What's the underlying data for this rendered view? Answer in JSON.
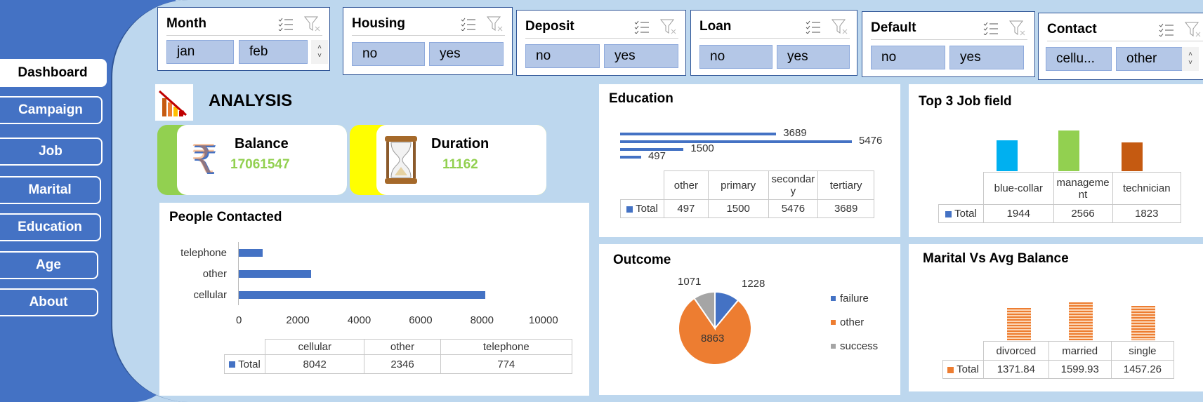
{
  "nav": [
    {
      "label": "Dashboard",
      "active": true
    },
    {
      "label": "Campaign"
    },
    {
      "label": "Job"
    },
    {
      "label": "Marital"
    },
    {
      "label": "Education"
    },
    {
      "label": "Age"
    },
    {
      "label": "About"
    }
  ],
  "slicers": {
    "month": {
      "title": "Month",
      "items": [
        "jan",
        "feb"
      ]
    },
    "housing": {
      "title": "Housing",
      "items": [
        "no",
        "yes"
      ]
    },
    "deposit": {
      "title": "Deposit",
      "items": [
        "no",
        "yes"
      ]
    },
    "loan": {
      "title": "Loan",
      "items": [
        "no",
        "yes"
      ]
    },
    "default": {
      "title": "Default",
      "items": [
        "no",
        "yes"
      ]
    },
    "contact": {
      "title": "Contact",
      "items": [
        "cellu...",
        "other"
      ]
    }
  },
  "analysis_title": "ANALYSIS",
  "kpis": {
    "balance": {
      "label": "Balance",
      "value": "17061547",
      "accent": "#92d050"
    },
    "duration": {
      "label": "Duration",
      "value": "11162",
      "accent": "#ffff00"
    }
  },
  "colors": {
    "blue": "#4472c4",
    "orange": "#ed7d31",
    "gray": "#a5a5a5",
    "green": "#92d050",
    "cyan": "#00b0f0",
    "rust": "#c55a11"
  },
  "people_contacted": {
    "title": "People Contacted",
    "row_label": "Total",
    "chart_data": {
      "type": "bar",
      "orientation": "horizontal",
      "categories": [
        "cellular",
        "other",
        "telephone"
      ],
      "values": [
        8042,
        2346,
        774
      ],
      "xlim": [
        0,
        10000
      ],
      "xticks": [
        "0",
        "2000",
        "4000",
        "6000",
        "8000",
        "10000"
      ]
    }
  },
  "education": {
    "title": "Education",
    "row_label": "Total",
    "table_headers": [
      "other",
      "primary",
      "secondar y",
      "tertiary"
    ],
    "chart_data": {
      "type": "bar",
      "orientation": "horizontal",
      "categories": [
        "other",
        "primary",
        "secondary",
        "tertiary"
      ],
      "values": [
        497,
        1500,
        5476,
        3689
      ],
      "labels": [
        "497",
        "1500",
        "5476",
        "3689"
      ]
    }
  },
  "top_jobs": {
    "title": "Top 3 Job field",
    "row_label": "Total",
    "table_headers": [
      "blue-collar",
      "manageme nt",
      "technician"
    ],
    "chart_data": {
      "type": "bar",
      "categories": [
        "blue-collar",
        "management",
        "technician"
      ],
      "values": [
        1944,
        2566,
        1823
      ],
      "colors": [
        "#00b0f0",
        "#92d050",
        "#c55a11"
      ],
      "labels": [
        "1944",
        "2566",
        "1823"
      ]
    }
  },
  "outcome": {
    "title": "Outcome",
    "chart_data": {
      "type": "pie",
      "categories": [
        "failure",
        "other",
        "success"
      ],
      "values": [
        1228,
        8863,
        1071
      ],
      "labels": [
        "1228",
        "8863",
        "1071"
      ],
      "colors": [
        "#4472c4",
        "#ed7d31",
        "#a5a5a5"
      ],
      "legend": "right"
    }
  },
  "marital": {
    "title": "Marital Vs Avg Balance",
    "row_label": "Total",
    "chart_data": {
      "type": "bar",
      "categories": [
        "divorced",
        "married",
        "single"
      ],
      "values": [
        1371.84,
        1599.93,
        1457.26
      ],
      "labels": [
        "1371.84",
        "1599.93",
        "1457.26"
      ],
      "color": "#ed7d31"
    }
  }
}
